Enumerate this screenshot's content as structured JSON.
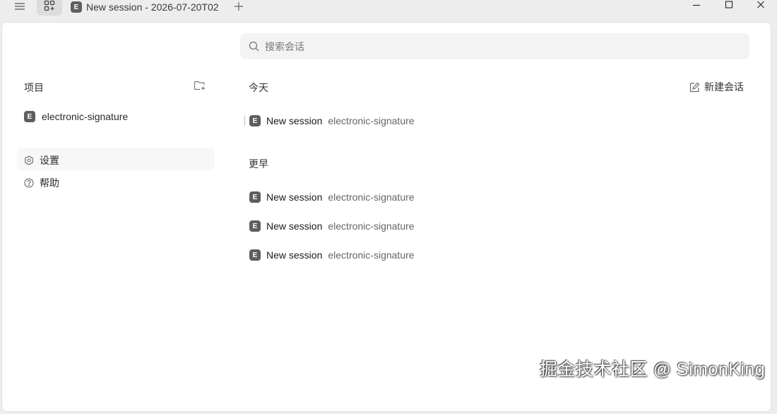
{
  "titlebar": {
    "tab_badge": "E",
    "tab_title": "New session - 2026-07-20T02"
  },
  "search": {
    "placeholder": "搜索会话"
  },
  "sidebar": {
    "projects_label": "项目",
    "project": {
      "badge": "E",
      "name": "electronic-signature"
    },
    "settings_label": "设置",
    "help_label": "帮助"
  },
  "main": {
    "today_label": "今天",
    "new_chat_label": "新建会话",
    "earlier_label": "更早",
    "today_sessions": [
      {
        "badge": "E",
        "title": "New session",
        "project": "electronic-signature"
      }
    ],
    "earlier_sessions": [
      {
        "badge": "E",
        "title": "New session",
        "project": "electronic-signature"
      },
      {
        "badge": "E",
        "title": "New session",
        "project": "electronic-signature"
      },
      {
        "badge": "E",
        "title": "New session",
        "project": "electronic-signature"
      }
    ]
  },
  "watermark": "掘金技术社区 @ SimonKing",
  "colors": {
    "badge_bg": "#5e5e5e",
    "panel_bg": "#ffffff",
    "window_bg": "#ededed",
    "search_bg": "#f3f3f3"
  }
}
